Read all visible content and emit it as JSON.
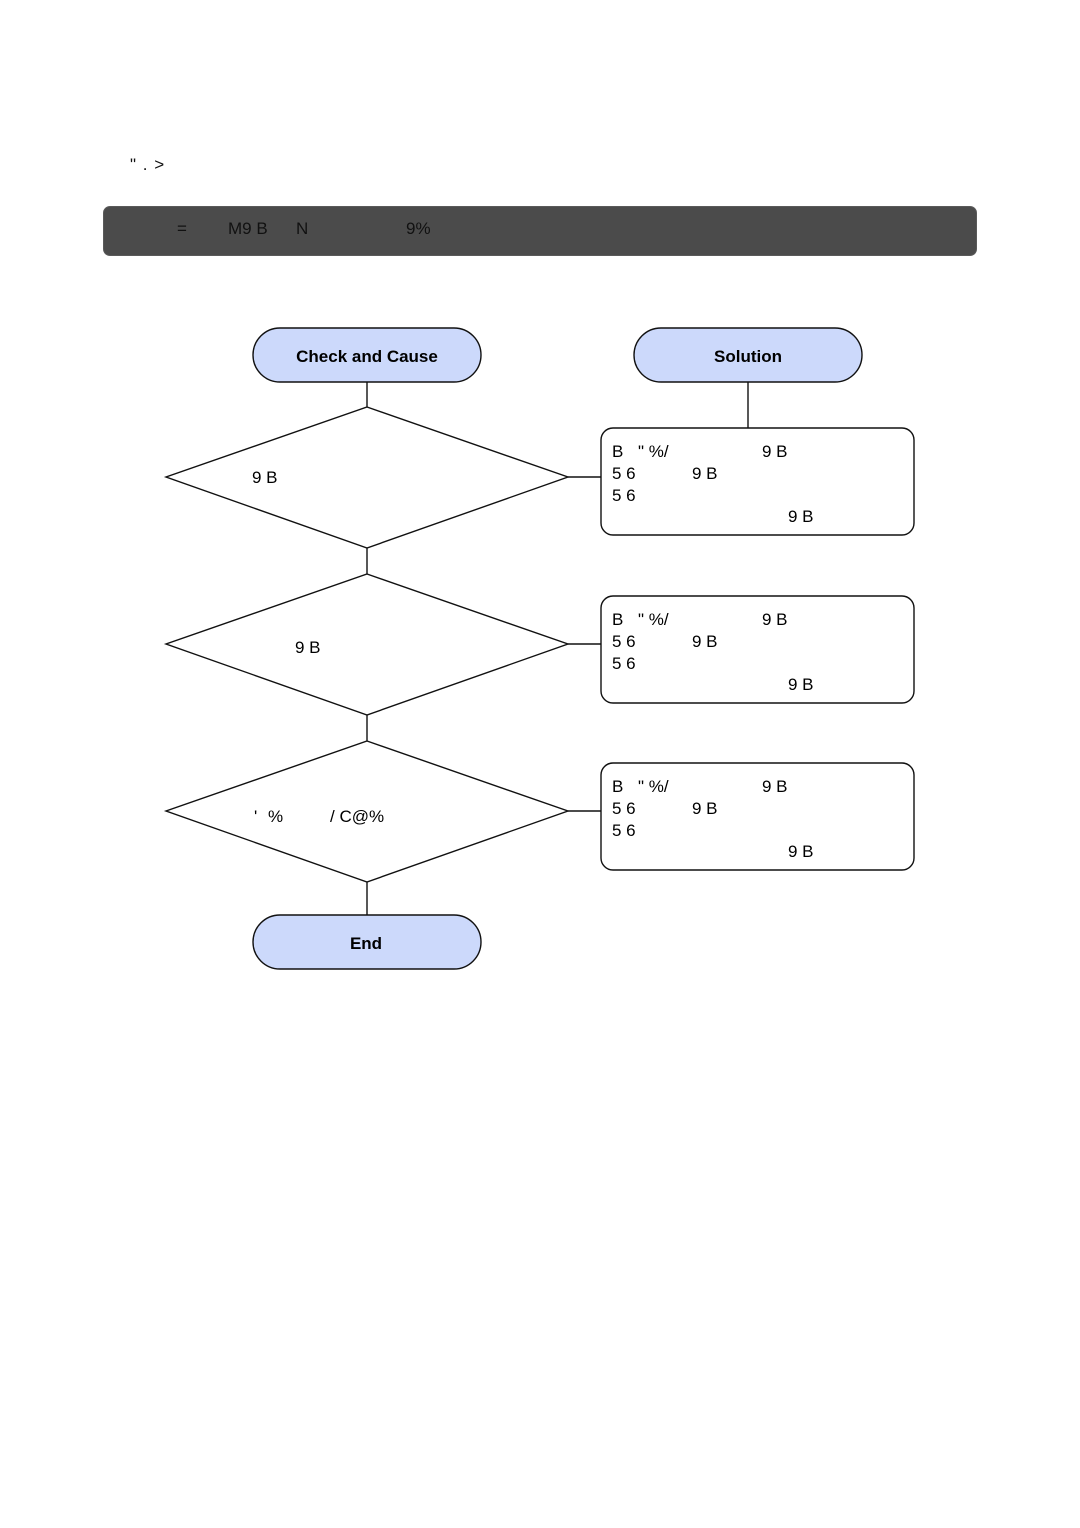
{
  "page": {
    "heading": "\" . >"
  },
  "title_bar": {
    "segments": [
      "=",
      "M9 B",
      "N",
      "9%"
    ]
  },
  "colors": {
    "terminal_fill": "#ccd9fb",
    "title_bar_bg": "#4b4b4b",
    "stroke": "#111111"
  },
  "flowchart": {
    "headers": {
      "check": "Check and Cause",
      "solution": "Solution"
    },
    "end_label": "End",
    "steps": [
      {
        "decision": [
          "9 B"
        ],
        "solution_lines": [
          [
            "B",
            "\" %/",
            "9 B"
          ],
          [
            "5 6",
            "9 B"
          ],
          [
            "5 6"
          ],
          [
            "9 B"
          ]
        ]
      },
      {
        "decision": [
          "9 B"
        ],
        "solution_lines": [
          [
            "B",
            "\" %/",
            "9 B"
          ],
          [
            "5 6",
            "9 B"
          ],
          [
            "5 6"
          ],
          [
            "9 B"
          ]
        ]
      },
      {
        "decision": [
          "'",
          "%",
          "/ C@%"
        ],
        "solution_lines": [
          [
            "B",
            "\" %/",
            "9 B"
          ],
          [
            "5 6",
            "9 B"
          ],
          [
            "5 6"
          ],
          [
            "9 B"
          ]
        ]
      }
    ]
  }
}
